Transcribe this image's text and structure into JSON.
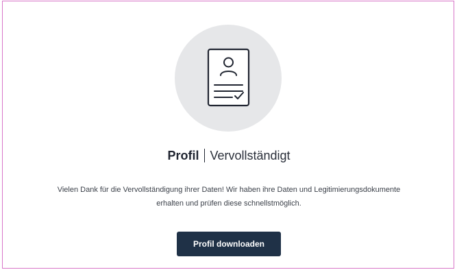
{
  "status": {
    "title_bold": "Profil",
    "title_rest": "Vervollständigt",
    "icon": "profile-document-check-icon"
  },
  "message": {
    "line1": "Vielen Dank für die Vervollständigung ihrer Daten! Wir haben ihre Daten und Legitimierungsdokumente",
    "line2": "erhalten und prüfen diese schnellstmöglich."
  },
  "actions": {
    "download_label": "Profil downloaden"
  },
  "colors": {
    "frame_border": "#d874c8",
    "icon_circle": "#e6e7e9",
    "button_bg": "#1f3147",
    "text_dark": "#1f2430"
  }
}
